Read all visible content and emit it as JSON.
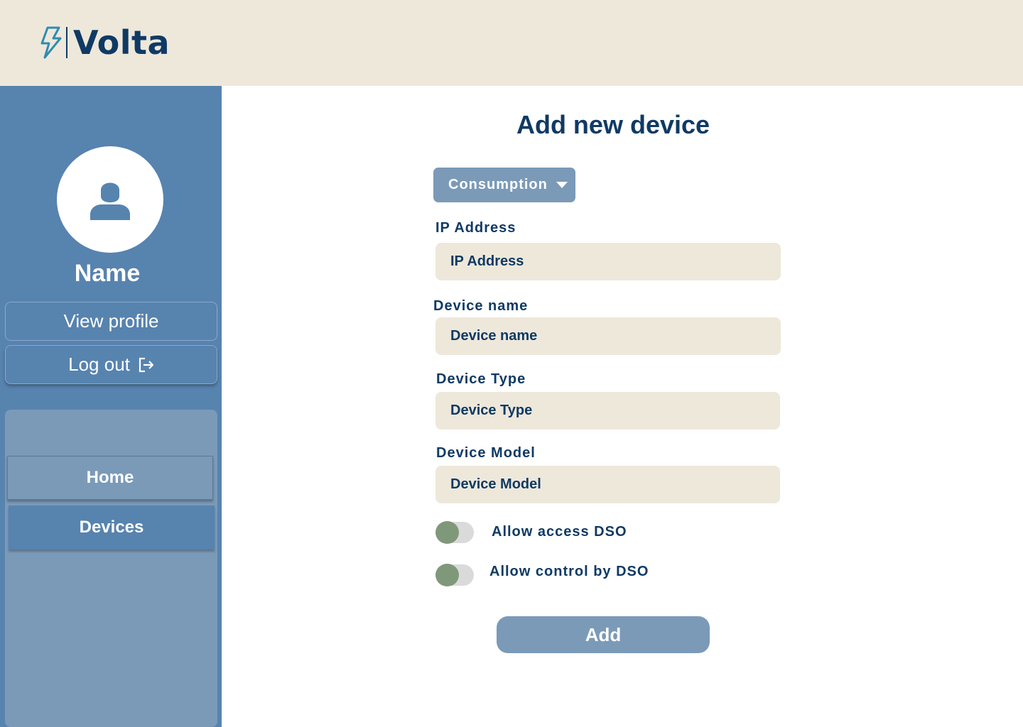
{
  "header": {
    "logo_text": "Volta",
    "logo_icon": "lightning-bolt-icon"
  },
  "sidebar": {
    "user_name": "Name",
    "avatar_icon": "user-icon",
    "view_profile_label": "View profile",
    "logout_label": "Log out",
    "logout_icon": "logout-icon",
    "nav": {
      "home_label": "Home",
      "devices_label": "Devices",
      "active": "Devices"
    }
  },
  "form": {
    "title": "Add new device",
    "type_select": {
      "selected": "Consumption",
      "icon": "caret-down-icon"
    },
    "ip_address": {
      "label": "IP Address",
      "placeholder": "IP Address"
    },
    "device_name": {
      "label": "Device name",
      "placeholder": "Device name"
    },
    "device_type": {
      "label": "Device Type",
      "placeholder": "Device Type"
    },
    "device_model": {
      "label": "Device Model",
      "placeholder": "Device Model"
    },
    "allow_access_dso": {
      "label": "Allow access DSO",
      "checked": false
    },
    "allow_control_dso": {
      "label": "Allow control by DSO",
      "checked": false
    },
    "submit_label": "Add"
  },
  "colors": {
    "header_bg": "#EEE8DB",
    "sidebar_bg": "#5783AF",
    "nav_panel_bg": "#7B9AB8",
    "brand_dark": "#0F3A64",
    "input_bg": "#EEE8DB",
    "toggle_knob": "#80987A"
  }
}
